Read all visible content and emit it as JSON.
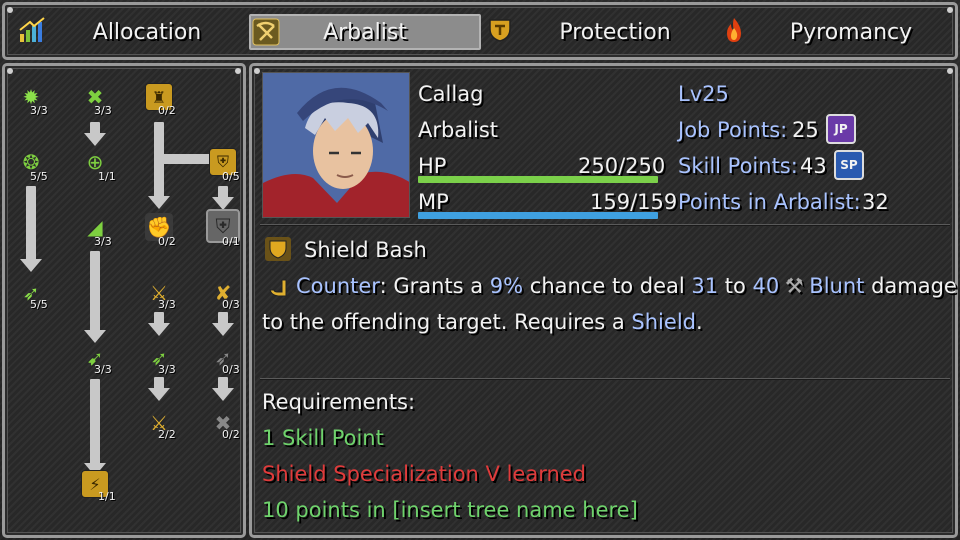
{
  "tabs": [
    {
      "label": "Allocation",
      "icon": "bar-chart-icon",
      "active": false
    },
    {
      "label": "Arbalist",
      "icon": "crossbow-icon",
      "active": true
    },
    {
      "label": "Protection",
      "icon": "shield-icon",
      "active": false
    },
    {
      "label": "Pyromancy",
      "icon": "fire-icon",
      "active": false
    }
  ],
  "tree": {
    "nodes": [
      {
        "count": "3/3",
        "icon": "green-burst-icon"
      },
      {
        "count": "5/5",
        "icon": "green-swirl-icon"
      },
      {
        "count": "5/5",
        "icon": "green-arrow-icon"
      },
      {
        "count": "3/3",
        "icon": "crossed-arrows-icon"
      },
      {
        "count": "1/1",
        "icon": "target-icon"
      },
      {
        "count": "3/3",
        "icon": "wing-icon"
      },
      {
        "count": "3/3",
        "icon": "feather-arrows-icon"
      },
      {
        "count": "1/1",
        "icon": "gold-emblem-icon"
      },
      {
        "count": "0/2",
        "icon": "tower-icon"
      },
      {
        "count": "0/2",
        "icon": "fist-shield-icon"
      },
      {
        "count": "3/3",
        "icon": "crossbow-icon"
      },
      {
        "count": "3/3",
        "icon": "arrow-volley-icon"
      },
      {
        "count": "2/2",
        "icon": "crossbow-icon"
      },
      {
        "count": "0/5",
        "icon": "double-shield-icon"
      },
      {
        "count": "0/1",
        "icon": "shield-bash-icon"
      },
      {
        "count": "0/3",
        "icon": "crossed-crossbows-icon"
      },
      {
        "count": "0/3",
        "icon": "arrow-volley-icon"
      },
      {
        "count": "0/2",
        "icon": "crossed-bolts-icon"
      }
    ]
  },
  "character": {
    "name": "Callag",
    "job": "Arbalist",
    "level": "Lv25",
    "hp_label": "HP",
    "hp_value": "250/250",
    "hp_fraction": 1.0,
    "mp_label": "MP",
    "mp_value": "159/159",
    "mp_fraction": 1.0,
    "job_points_label": "Job Points:",
    "job_points": "25",
    "job_points_badge": "JP",
    "skill_points_label": "Skill Points:",
    "skill_points": "43",
    "skill_points_badge": "SP",
    "points_in_label": "Points in Arbalist:",
    "points_in": "32"
  },
  "skill": {
    "name": "Shield Bash",
    "counter_word": "Counter",
    "desc1_a": ": Grants a ",
    "chance": "9%",
    "desc1_b": " chance to deal ",
    "dmg_min": "31",
    "desc1_c": " to ",
    "dmg_max": "40",
    "element": "Blunt",
    "desc1_d": " damage",
    "desc2_a": "to the offending target. Requires a ",
    "req_item": "Shield",
    "desc2_b": "."
  },
  "requirements": {
    "title": "Requirements:",
    "items": [
      {
        "text": "1 Skill Point",
        "met": true
      },
      {
        "text": "Shield Specialization V learned",
        "met": false
      },
      {
        "text": "10 points in [insert tree name here]",
        "met": true
      }
    ]
  },
  "colors": {
    "hp": "#7bd04a",
    "mp": "#3fa0e0",
    "met": "#6fd36c",
    "unmet": "#e03b3b",
    "highlight": "#a9c3ff"
  }
}
